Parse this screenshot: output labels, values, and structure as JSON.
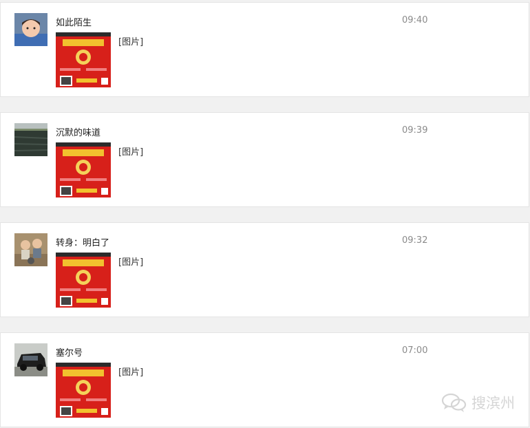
{
  "accent": "#d7201a",
  "messages": [
    {
      "name": "如此陌生",
      "time": "09:40",
      "caption": "[图片]",
      "avatar": "child-avatar"
    },
    {
      "name": "沉默的味道",
      "time": "09:39",
      "caption": "[图片]",
      "avatar": "lake-avatar"
    },
    {
      "name": "转身：明白了",
      "time": "09:32",
      "caption": "[图片]",
      "avatar": "kids-avatar"
    },
    {
      "name": "塞尔号",
      "time": "07:00",
      "caption": "[图片]",
      "avatar": "car-avatar"
    }
  ],
  "watermark": {
    "text": "搜滨州",
    "icon": "wechat-icon"
  }
}
